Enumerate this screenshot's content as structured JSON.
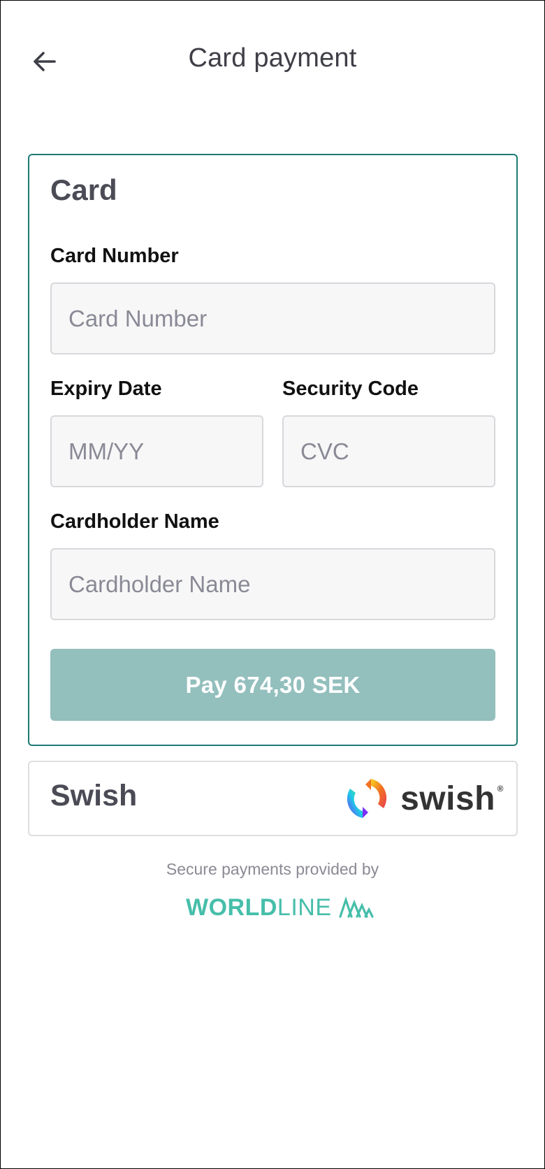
{
  "header": {
    "title": "Card payment",
    "back_icon": "arrow-left-icon"
  },
  "card": {
    "title": "Card",
    "card_number": {
      "label": "Card Number",
      "placeholder": "Card Number",
      "value": ""
    },
    "expiry": {
      "label": "Expiry Date",
      "placeholder": "MM/YY",
      "value": ""
    },
    "security_code": {
      "label": "Security Code",
      "placeholder": "CVC",
      "value": ""
    },
    "cardholder": {
      "label": "Cardholder Name",
      "placeholder": "Cardholder Name",
      "value": ""
    },
    "pay_button_label": "Pay 674,30 SEK"
  },
  "swish": {
    "label": "Swish",
    "logo_text": "swish",
    "logo_mark": "®"
  },
  "footer": {
    "secure_text": "Secure payments provided by",
    "provider_bold": "WORLD",
    "provider_light": "LINE"
  },
  "colors": {
    "accent": "#1d7a76",
    "pay_button": "#93bfbd",
    "worldline": "#46beaa"
  }
}
